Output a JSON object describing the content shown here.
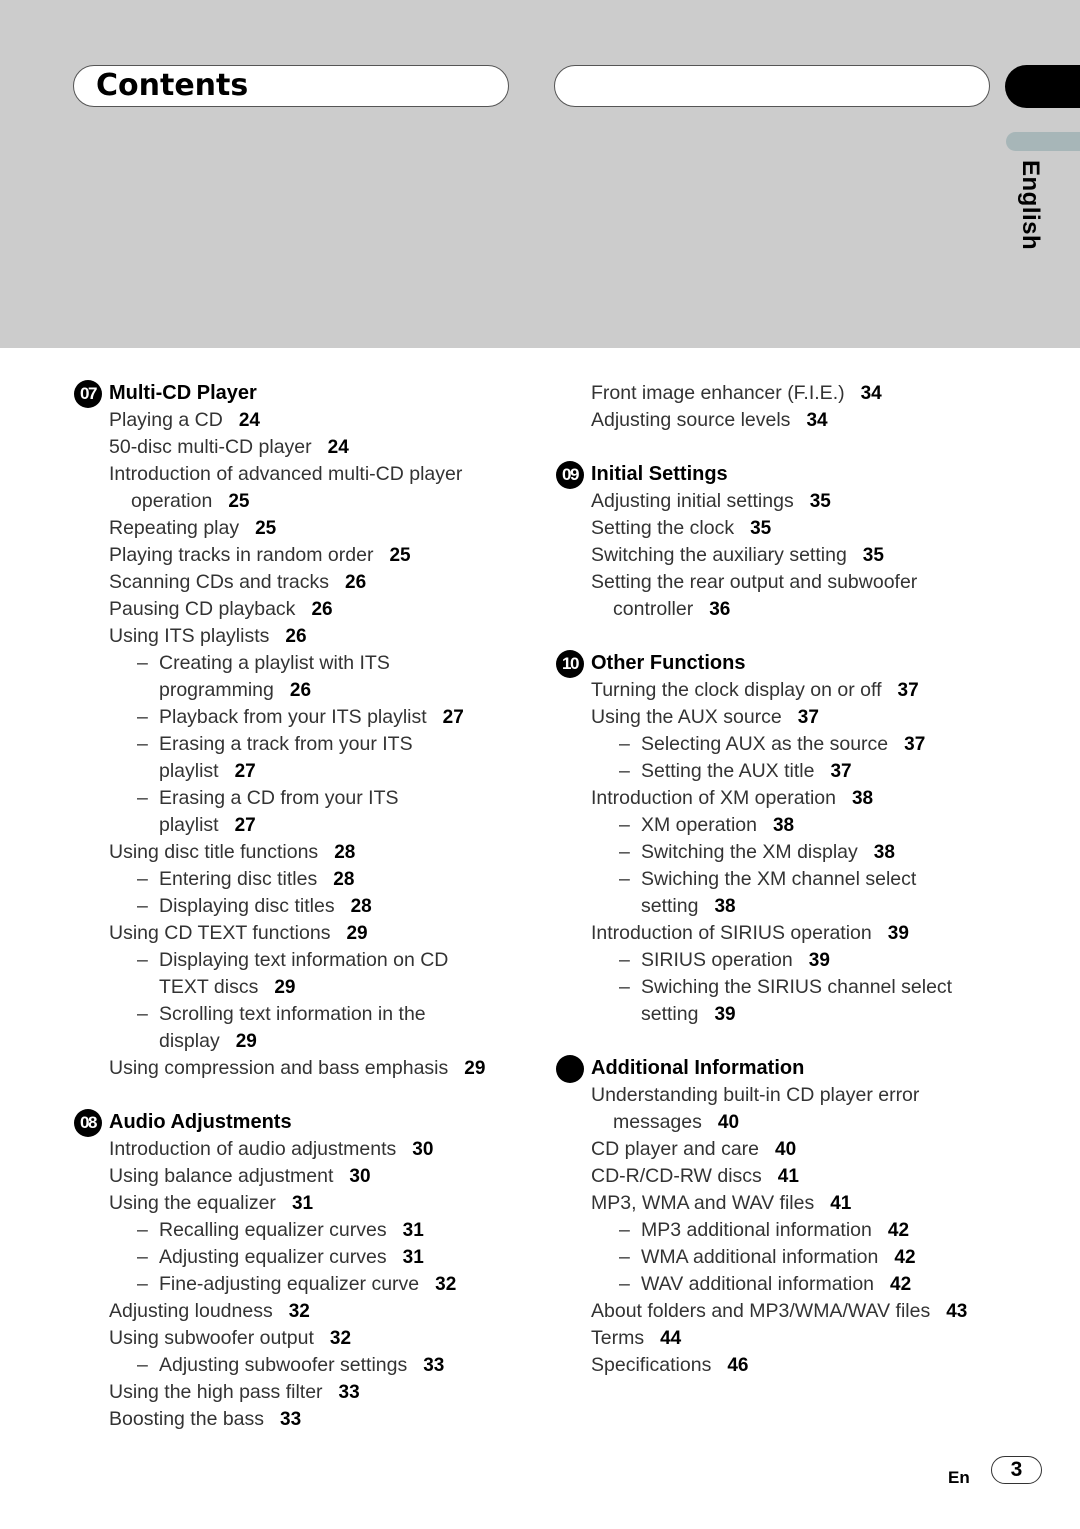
{
  "header": {
    "title": "Contents",
    "language_tab": "English"
  },
  "columns": [
    {
      "sections": [
        {
          "badge": "07",
          "title": "Multi-CD Player",
          "entries": [
            {
              "level": 1,
              "lines": [
                "Playing a CD"
              ],
              "page": "24"
            },
            {
              "level": 1,
              "lines": [
                "50-disc multi-CD player"
              ],
              "page": "24"
            },
            {
              "level": 1,
              "lines": [
                "Introduction of advanced multi-CD player",
                "operation"
              ],
              "page": "25"
            },
            {
              "level": 1,
              "lines": [
                "Repeating play"
              ],
              "page": "25"
            },
            {
              "level": 1,
              "lines": [
                "Playing tracks in random order"
              ],
              "page": "25"
            },
            {
              "level": 1,
              "lines": [
                "Scanning CDs and tracks"
              ],
              "page": "26"
            },
            {
              "level": 1,
              "lines": [
                "Pausing CD playback"
              ],
              "page": "26"
            },
            {
              "level": 1,
              "lines": [
                "Using ITS playlists"
              ],
              "page": "26"
            },
            {
              "level": 2,
              "lines": [
                "Creating a playlist with ITS",
                "programming"
              ],
              "page": "26"
            },
            {
              "level": 2,
              "lines": [
                "Playback from your ITS playlist"
              ],
              "page": "27"
            },
            {
              "level": 2,
              "lines": [
                "Erasing a track from your ITS",
                "playlist"
              ],
              "page": "27"
            },
            {
              "level": 2,
              "lines": [
                "Erasing a CD from your ITS",
                "playlist"
              ],
              "page": "27"
            },
            {
              "level": 1,
              "lines": [
                "Using disc title functions"
              ],
              "page": "28"
            },
            {
              "level": 2,
              "lines": [
                "Entering disc titles"
              ],
              "page": "28"
            },
            {
              "level": 2,
              "lines": [
                "Displaying disc titles"
              ],
              "page": "28"
            },
            {
              "level": 1,
              "lines": [
                "Using CD TEXT functions"
              ],
              "page": "29"
            },
            {
              "level": 2,
              "lines": [
                "Displaying text information on CD",
                "TEXT discs"
              ],
              "page": "29"
            },
            {
              "level": 2,
              "lines": [
                "Scrolling text information in the",
                "display"
              ],
              "page": "29"
            },
            {
              "level": 1,
              "lines": [
                "Using compression and bass emphasis"
              ],
              "page": "29"
            }
          ]
        },
        {
          "badge": "08",
          "title": "Audio Adjustments",
          "entries": [
            {
              "level": 1,
              "lines": [
                "Introduction of audio adjustments"
              ],
              "page": "30"
            },
            {
              "level": 1,
              "lines": [
                "Using balance adjustment"
              ],
              "page": "30"
            },
            {
              "level": 1,
              "lines": [
                "Using the equalizer"
              ],
              "page": "31"
            },
            {
              "level": 2,
              "lines": [
                "Recalling equalizer curves"
              ],
              "page": "31"
            },
            {
              "level": 2,
              "lines": [
                "Adjusting equalizer curves"
              ],
              "page": "31"
            },
            {
              "level": 2,
              "lines": [
                "Fine-adjusting equalizer curve"
              ],
              "page": "32"
            },
            {
              "level": 1,
              "lines": [
                "Adjusting loudness"
              ],
              "page": "32"
            },
            {
              "level": 1,
              "lines": [
                "Using subwoofer output"
              ],
              "page": "32"
            },
            {
              "level": 2,
              "lines": [
                "Adjusting subwoofer settings"
              ],
              "page": "33"
            },
            {
              "level": 1,
              "lines": [
                "Using the high pass filter"
              ],
              "page": "33"
            },
            {
              "level": 1,
              "lines": [
                "Boosting the bass"
              ],
              "page": "33"
            }
          ]
        }
      ]
    },
    {
      "sections": [
        {
          "badge": "",
          "title": "",
          "entries": [
            {
              "level": 1,
              "lines": [
                "Front image enhancer (F.I.E.)"
              ],
              "page": "34"
            },
            {
              "level": 1,
              "lines": [
                "Adjusting source levels"
              ],
              "page": "34"
            }
          ]
        },
        {
          "badge": "09",
          "title": "Initial Settings",
          "entries": [
            {
              "level": 1,
              "lines": [
                "Adjusting initial settings"
              ],
              "page": "35"
            },
            {
              "level": 1,
              "lines": [
                "Setting the clock"
              ],
              "page": "35"
            },
            {
              "level": 1,
              "lines": [
                "Switching the auxiliary setting"
              ],
              "page": "35"
            },
            {
              "level": 1,
              "lines": [
                "Setting the rear output and subwoofer",
                "controller"
              ],
              "page": "36"
            }
          ]
        },
        {
          "badge": "10",
          "title": "Other Functions",
          "entries": [
            {
              "level": 1,
              "lines": [
                "Turning the clock display on or off"
              ],
              "page": "37"
            },
            {
              "level": 1,
              "lines": [
                "Using the AUX source"
              ],
              "page": "37"
            },
            {
              "level": 2,
              "lines": [
                "Selecting AUX as the source"
              ],
              "page": "37"
            },
            {
              "level": 2,
              "lines": [
                "Setting the AUX title"
              ],
              "page": "37"
            },
            {
              "level": 1,
              "lines": [
                "Introduction of XM operation"
              ],
              "page": "38"
            },
            {
              "level": 2,
              "lines": [
                "XM operation"
              ],
              "page": "38"
            },
            {
              "level": 2,
              "lines": [
                "Switching the XM display"
              ],
              "page": "38"
            },
            {
              "level": 2,
              "lines": [
                "Swiching the XM channel select",
                "setting"
              ],
              "page": "38"
            },
            {
              "level": 1,
              "lines": [
                "Introduction of SIRIUS operation"
              ],
              "page": "39"
            },
            {
              "level": 2,
              "lines": [
                "SIRIUS operation"
              ],
              "page": "39"
            },
            {
              "level": 2,
              "lines": [
                "Swiching the SIRIUS channel select",
                "setting"
              ],
              "page": "39"
            }
          ]
        },
        {
          "badge": " ",
          "title": "Additional Information",
          "entries": [
            {
              "level": 1,
              "lines": [
                "Understanding built-in CD player error",
                "messages"
              ],
              "page": "40"
            },
            {
              "level": 1,
              "lines": [
                "CD player and care"
              ],
              "page": "40"
            },
            {
              "level": 1,
              "lines": [
                "CD-R/CD-RW discs"
              ],
              "page": "41"
            },
            {
              "level": 1,
              "lines": [
                "MP3, WMA and WAV files"
              ],
              "page": "41"
            },
            {
              "level": 2,
              "lines": [
                "MP3 additional information"
              ],
              "page": "42"
            },
            {
              "level": 2,
              "lines": [
                "WMA additional information"
              ],
              "page": "42"
            },
            {
              "level": 2,
              "lines": [
                "WAV additional information"
              ],
              "page": "42"
            },
            {
              "level": 1,
              "lines": [
                "About folders and MP3/WMA/WAV files"
              ],
              "page": "43"
            },
            {
              "level": 1,
              "lines": [
                "Terms"
              ],
              "page": "44"
            },
            {
              "level": 1,
              "lines": [
                "Specifications"
              ],
              "page": "46"
            }
          ]
        }
      ]
    }
  ],
  "footer": {
    "lang_code": "En",
    "page_number": "3"
  }
}
